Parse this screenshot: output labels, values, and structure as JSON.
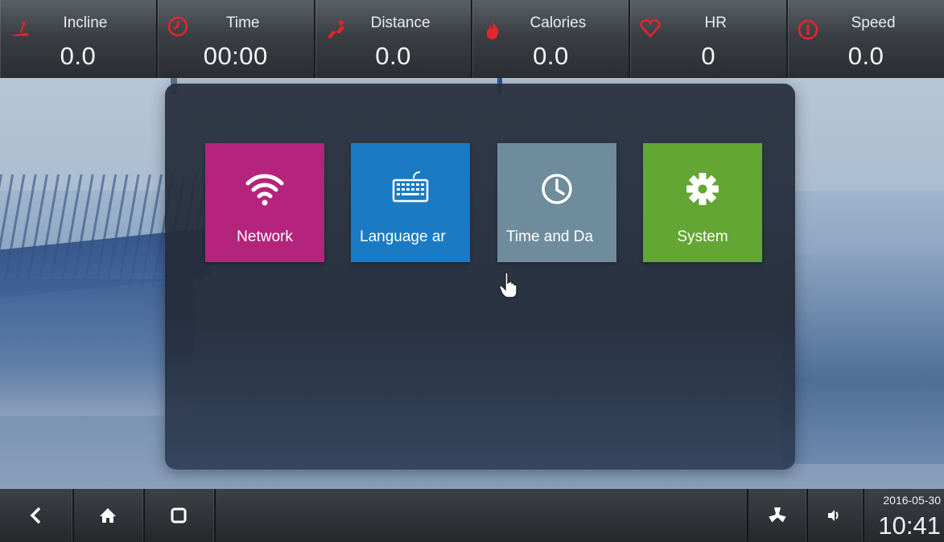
{
  "stats": [
    {
      "label": "Incline",
      "value": "0.0",
      "icon": "incline-icon"
    },
    {
      "label": "Time",
      "value": "00:00",
      "icon": "clock-icon"
    },
    {
      "label": "Distance",
      "value": "0.0",
      "icon": "runner-icon"
    },
    {
      "label": "Calories",
      "value": "0.0",
      "icon": "flame-icon"
    },
    {
      "label": "HR",
      "value": "0",
      "icon": "heart-icon"
    },
    {
      "label": "Speed",
      "value": "0.0",
      "icon": "speedometer-icon"
    }
  ],
  "settings_tiles": [
    {
      "label": "Network",
      "icon": "wifi-icon",
      "color": "#b5247c"
    },
    {
      "label": "Language ar",
      "icon": "keyboard-icon",
      "color": "#1a7bc4"
    },
    {
      "label": "Time and Da",
      "icon": "clock-icon",
      "color": "#6f8c9c"
    },
    {
      "label": "System",
      "icon": "gear-icon",
      "color": "#63a633"
    }
  ],
  "navbar": {
    "back_icon": "chevron-left-icon",
    "home_icon": "home-icon",
    "recent_icon": "square-icon",
    "fan_icon": "fan-icon",
    "volume_icon": "speaker-icon",
    "date": "2016-05-30",
    "time": "10:41"
  },
  "colors": {
    "stat_icon_red": "#e8252b"
  }
}
